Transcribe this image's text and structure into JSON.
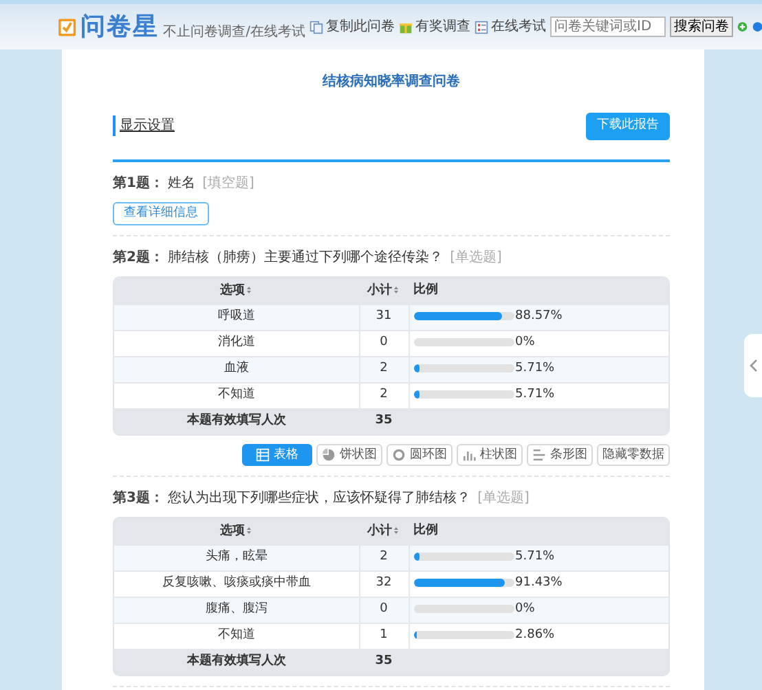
{
  "header": {
    "logo": "问卷星",
    "tagline": "不止问卷调查/在线考试",
    "links": [
      {
        "label": "复制此问卷",
        "kind": "copy"
      },
      {
        "label": "有奖调查",
        "kind": "gift"
      },
      {
        "label": "在线考试",
        "kind": "exam"
      }
    ],
    "search": {
      "placeholder": "问卷关键词或ID",
      "button": "搜索问卷"
    }
  },
  "title": "结核病知晓率调查问卷",
  "settings_link": "显示设置",
  "download_button": "下载此报告",
  "questions": [
    {
      "kind": "text",
      "number": "第1题：",
      "text": "姓名",
      "type": "[填空题]",
      "detail_button": "查看详细信息"
    },
    {
      "kind": "choice",
      "number": "第2题：",
      "text": "肺结核（肺痨）主要通过下列哪个途径传染？",
      "type": "[单选题]",
      "table": {
        "columns": [
          "选项",
          "小计",
          "比例"
        ],
        "rows": [
          {
            "option": "呼吸道",
            "count": "31",
            "level": 0.8857,
            "percent": "88.57%"
          },
          {
            "option": "消化道",
            "count": "0",
            "level": 0,
            "percent": "0%"
          },
          {
            "option": "血液",
            "count": "2",
            "level": 0.0571,
            "percent": "5.71%"
          },
          {
            "option": "不知道",
            "count": "2",
            "level": 0.0571,
            "percent": "5.71%"
          }
        ],
        "total_label": "本题有效填写人次",
        "total": "35"
      },
      "view_buttons": [
        {
          "label": "表格",
          "kind": "table",
          "selected": true
        },
        {
          "label": "饼状图",
          "kind": "pie",
          "selected": false
        },
        {
          "label": "圆环图",
          "kind": "donut",
          "selected": false
        },
        {
          "label": "柱状图",
          "kind": "column",
          "selected": false
        },
        {
          "label": "条形图",
          "kind": "bar",
          "selected": false
        },
        {
          "label": "隐藏零数据",
          "kind": "hide",
          "selected": false
        }
      ]
    },
    {
      "kind": "choice",
      "number": "第3题：",
      "text": "您认为出现下列哪些症状，应该怀疑得了肺结核？",
      "type": "[单选题]",
      "table": {
        "columns": [
          "选项",
          "小计",
          "比例"
        ],
        "rows": [
          {
            "option": "头痛，眩晕",
            "count": "2",
            "level": 0.0571,
            "percent": "5.71%"
          },
          {
            "option": "反复咳嗽、咳痰或痰中带血",
            "count": "32",
            "level": 0.9143,
            "percent": "91.43%"
          },
          {
            "option": "腹痛、腹泻",
            "count": "0",
            "level": 0,
            "percent": "0%"
          },
          {
            "option": "不知道",
            "count": "1",
            "level": 0.0286,
            "percent": "2.86%"
          }
        ],
        "total_label": "本题有效填写人次",
        "total": "35"
      }
    }
  ]
}
